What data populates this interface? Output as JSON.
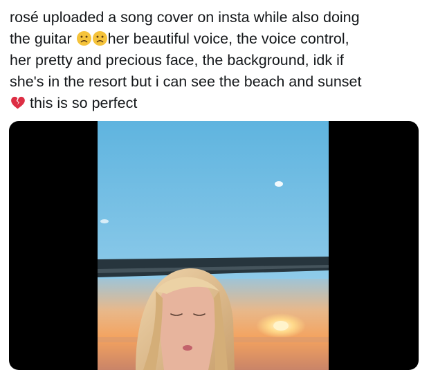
{
  "tweet": {
    "line1": "rosé uploaded a song cover on insta while also doing",
    "line2_before": "the guitar ",
    "line2_after": "her beautiful voice, the voice control,",
    "line3": "her pretty and precious face, the background, idk if",
    "line4": "she's in the resort but i can see the beach and sunset",
    "line5_after": " this is so perfect",
    "emojis": [
      "slightly-frowning-face-icon",
      "slightly-frowning-face-icon",
      "broken-heart-icon"
    ]
  },
  "media": {
    "type": "video",
    "scene": "sky-beach-sunset",
    "colors": {
      "sky_top": "#5fb4df",
      "sky_bottom": "#b6dcf0",
      "sunset": "#f4a35f",
      "hair": "#e6c79a",
      "background_bars": "#000000"
    }
  }
}
